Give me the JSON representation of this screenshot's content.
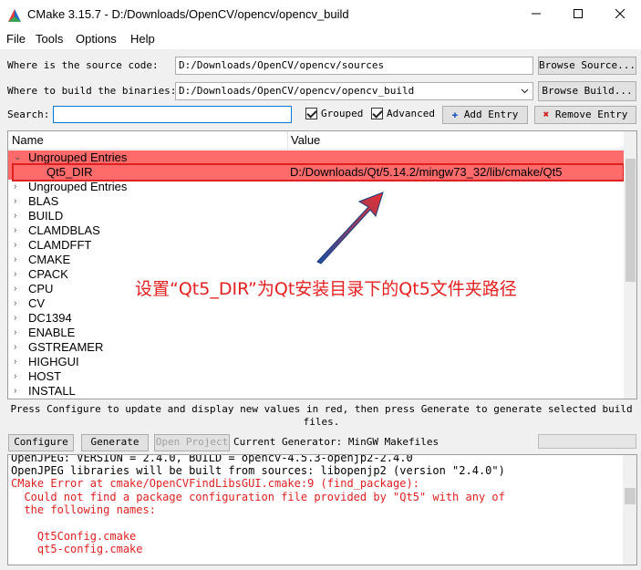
{
  "window": {
    "title": "CMake 3.15.7 - D:/Downloads/OpenCV/opencv/opencv_build"
  },
  "menu": [
    "File",
    "Tools",
    "Options",
    "Help"
  ],
  "source": {
    "label": "Where is the source code:",
    "value": "D:/Downloads/OpenCV/opencv/sources",
    "button": "Browse Source..."
  },
  "build": {
    "label": "Where to build the binaries:",
    "value": "D:/Downloads/OpenCV/opencv/opencv_build",
    "button": "Browse Build..."
  },
  "search": {
    "label": "Search:",
    "value": "",
    "grouped_label": "Grouped",
    "grouped_checked": true,
    "advanced_label": "Advanced",
    "advanced_checked": true,
    "add_entry": "Add Entry",
    "remove_entry": "Remove Entry"
  },
  "table": {
    "col_name": "Name",
    "col_value": "Value",
    "rows": [
      {
        "name": "Ungrouped Entries",
        "value": "",
        "expanded": true,
        "highlight": true
      },
      {
        "name": "Qt5_DIR",
        "value": "D:/Downloads/Qt/5.14.2/mingw73_32/lib/cmake/Qt5",
        "child": true,
        "highlight": true
      },
      {
        "name": "Ungrouped Entries",
        "value": ""
      },
      {
        "name": "BLAS",
        "value": ""
      },
      {
        "name": "BUILD",
        "value": ""
      },
      {
        "name": "CLAMDBLAS",
        "value": ""
      },
      {
        "name": "CLAMDFFT",
        "value": ""
      },
      {
        "name": "CMAKE",
        "value": ""
      },
      {
        "name": "CPACK",
        "value": ""
      },
      {
        "name": "CPU",
        "value": ""
      },
      {
        "name": "CV",
        "value": ""
      },
      {
        "name": "DC1394",
        "value": ""
      },
      {
        "name": "ENABLE",
        "value": ""
      },
      {
        "name": "GSTREAMER",
        "value": ""
      },
      {
        "name": "HIGHGUI",
        "value": ""
      },
      {
        "name": "HOST",
        "value": ""
      },
      {
        "name": "INSTALL",
        "value": ""
      }
    ]
  },
  "annotation": "设置“Qt5_DIR”为Qt安装目录下的Qt5文件夹路径",
  "hint": "Press Configure to update and display new values in red, then press Generate to generate selected build files.",
  "actions": {
    "configure": "Configure",
    "generate": "Generate",
    "open_project": "Open Project",
    "generator": "Current Generator: MinGW Makefiles"
  },
  "log": [
    {
      "text": "OpenJPEG: VERSION = 2.4.0, BUILD = opencv-4.5.3-openjp2-2.4.0",
      "error": false
    },
    {
      "text": "OpenJPEG libraries will be built from sources: libopenjp2 (version \"2.4.0\")",
      "error": false
    },
    {
      "text": "CMake Error at cmake/OpenCVFindLibsGUI.cmake:9 (find_package):",
      "error": true
    },
    {
      "text": "  Could not find a package configuration file provided by \"Qt5\" with any of",
      "error": true
    },
    {
      "text": "  the following names:",
      "error": true
    },
    {
      "text": "",
      "error": true
    },
    {
      "text": "    Qt5Config.cmake",
      "error": true
    },
    {
      "text": "    qt5-config.cmake",
      "error": true
    }
  ],
  "colors": {
    "highlight_row": "#ff6b6b",
    "annotation": "#e52020",
    "error_text": "#e02020"
  }
}
